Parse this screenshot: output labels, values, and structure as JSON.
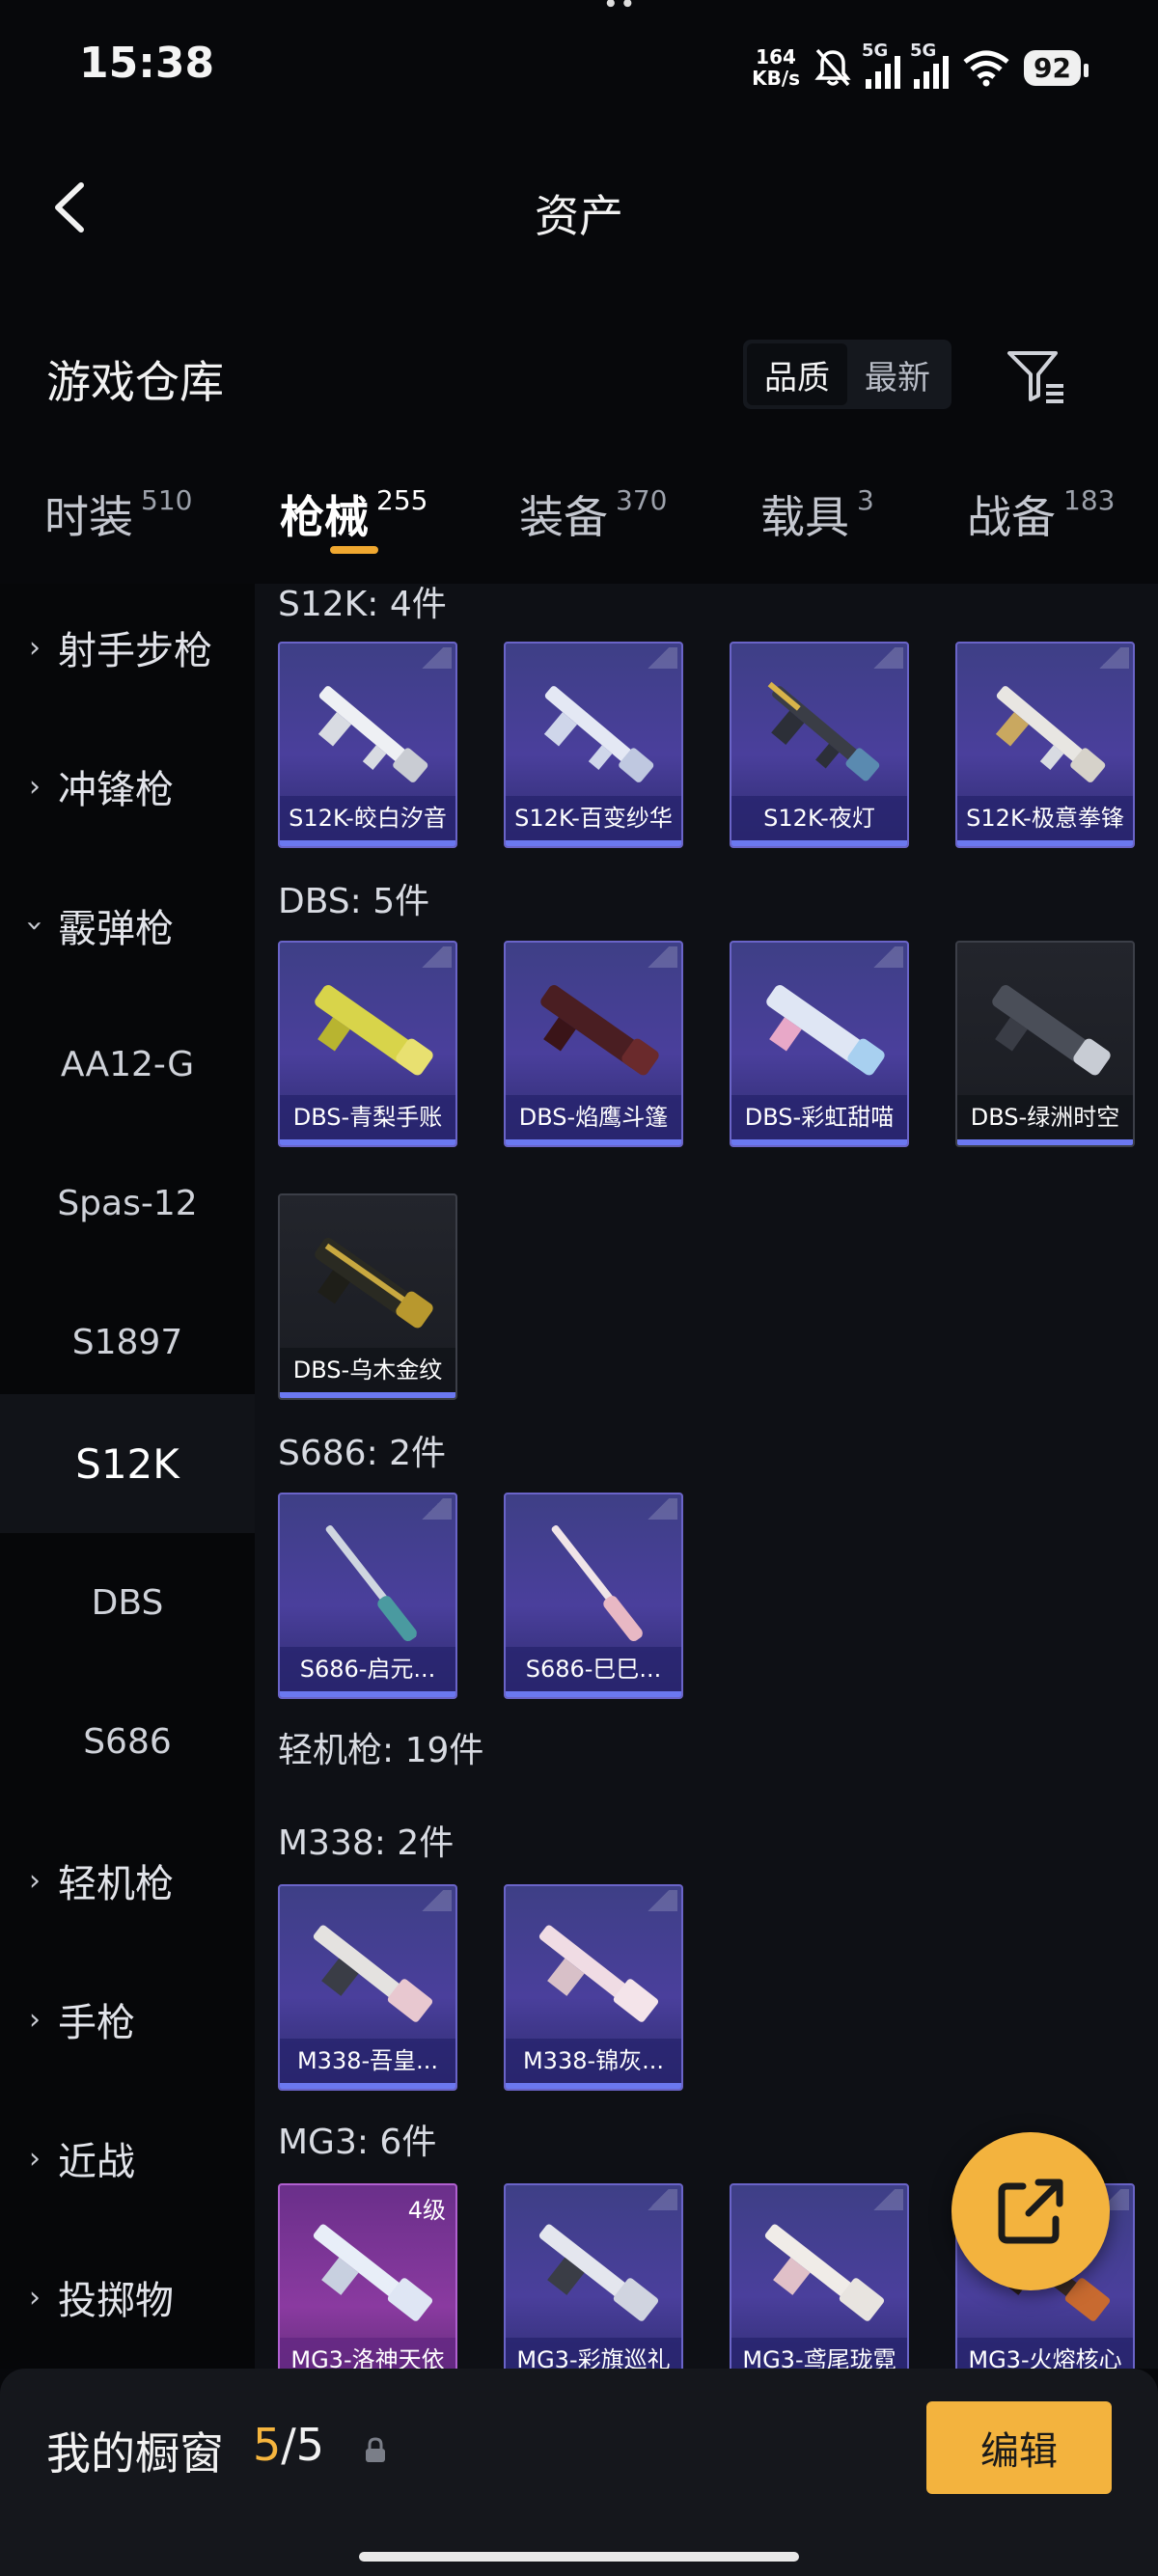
{
  "status_bar": {
    "time": "15:38",
    "net_speed_value": "164",
    "net_speed_unit": "KB/s",
    "signal1_label": "5G",
    "signal2_label": "5G",
    "battery": "92",
    "icons": [
      "mute-bell-icon",
      "signal-icon",
      "signal-icon",
      "wifi-icon",
      "battery-icon"
    ]
  },
  "header": {
    "title": "资产",
    "back_icon": "chevron-left-icon"
  },
  "warehouse": {
    "title": "游戏仓库",
    "sort_options": [
      "品质",
      "最新"
    ],
    "sort_selected": "品质",
    "filter_icon": "filter-icon"
  },
  "tabs": [
    {
      "label": "时装",
      "count": "510"
    },
    {
      "label": "枪械",
      "count": "255",
      "active": true
    },
    {
      "label": "装备",
      "count": "370"
    },
    {
      "label": "载具",
      "count": "3"
    },
    {
      "label": "战备",
      "count": "183"
    }
  ],
  "sidebar": {
    "categories": [
      {
        "label": "射手步枪",
        "expanded": false
      },
      {
        "label": "冲锋枪",
        "expanded": false
      },
      {
        "label": "霰弹枪",
        "expanded": true
      },
      {
        "label": "轻机枪",
        "expanded": false
      },
      {
        "label": "手枪",
        "expanded": false
      },
      {
        "label": "近战",
        "expanded": false
      },
      {
        "label": "投掷物",
        "expanded": false
      }
    ],
    "subitems": [
      "AA12-G",
      "Spas-12",
      "S1897",
      "S12K",
      "DBS",
      "S686"
    ],
    "selected_subitem": "S12K"
  },
  "content": {
    "sections": [
      {
        "header": "S12K: 4件",
        "items": [
          "S12K-皎白汐音",
          "S12K-百变纱华",
          "S12K-夜灯",
          "S12K-极意拳锋"
        ]
      },
      {
        "header": "DBS: 5件",
        "items": [
          "DBS-青梨手账",
          "DBS-焰鹰斗篷",
          "DBS-彩虹甜喵",
          "DBS-绿洲时空",
          "DBS-乌木金纹"
        ]
      },
      {
        "header": "S686: 2件",
        "items": [
          "S686-启元...",
          "S686-巳巳..."
        ]
      },
      {
        "header": "轻机枪: 19件",
        "items": []
      },
      {
        "header": "M338: 2件",
        "items": [
          "M338-吾皇...",
          "M338-锦灰..."
        ]
      },
      {
        "header": "MG3: 6件",
        "items": [
          "MG3-洛神天依",
          "MG3-彩旗巡礼",
          "MG3-鸢尾珑霓",
          "MG3-火熔核心"
        ]
      }
    ],
    "level_badge": "4级"
  },
  "fab_icon": "share-external-icon",
  "bottom_bar": {
    "label": "我的橱窗",
    "count_current": "5",
    "count_sep": "/",
    "count_total": "5",
    "lock_icon": "lock-icon",
    "edit_label": "编辑"
  },
  "colors": {
    "accent": "#f3b33e",
    "card_purple": "#4a3f9c",
    "card_gray": "#23252c",
    "card_pink": "#8a3aa0"
  }
}
